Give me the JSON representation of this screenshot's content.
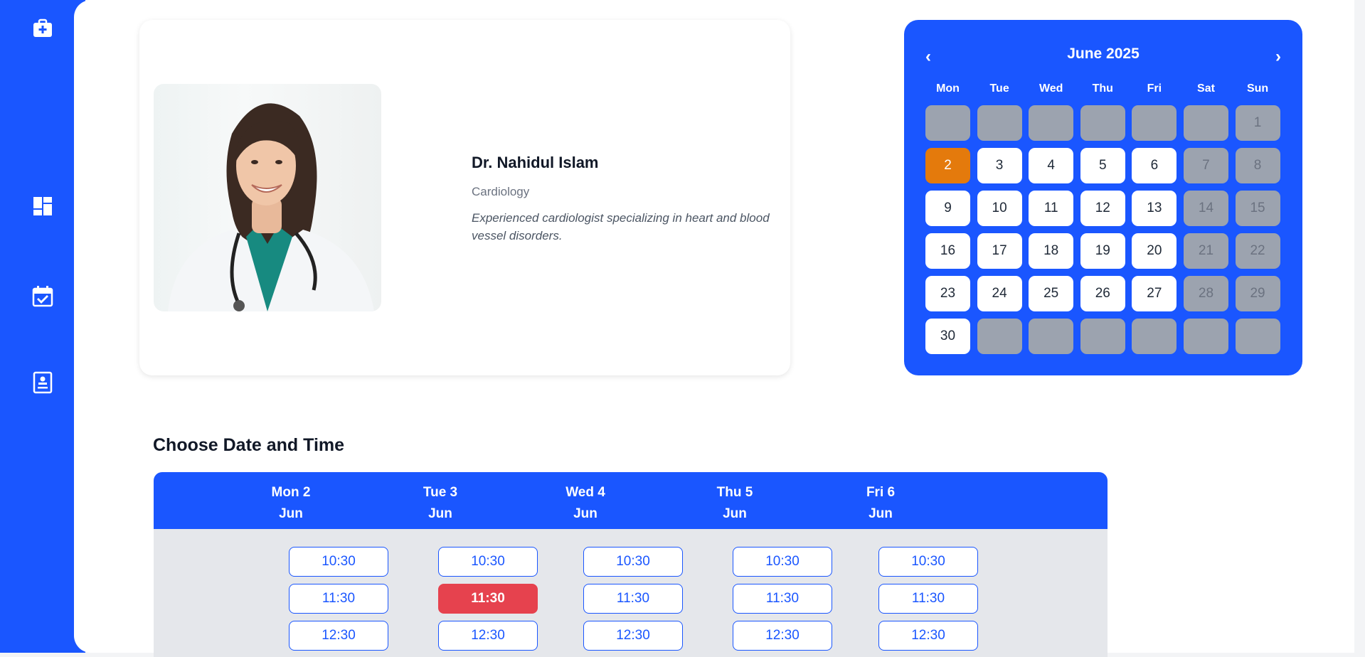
{
  "sidebar": {
    "icons": [
      "medical-kit-icon",
      "dashboard-icon",
      "calendar-check-icon",
      "profile-card-icon"
    ]
  },
  "doctor": {
    "name": "Dr. Nahidul Islam",
    "specialty": "Cardiology",
    "description": "Experienced cardiologist specializing in heart and blood vessel disorders."
  },
  "calendar": {
    "month_title": "June 2025",
    "prev_label": "‹",
    "next_label": "›",
    "weekdays": [
      "Mon",
      "Tue",
      "Wed",
      "Thu",
      "Fri",
      "Sat",
      "Sun"
    ],
    "cells": [
      {
        "label": "",
        "state": "empty"
      },
      {
        "label": "",
        "state": "empty"
      },
      {
        "label": "",
        "state": "empty"
      },
      {
        "label": "",
        "state": "empty"
      },
      {
        "label": "",
        "state": "empty"
      },
      {
        "label": "",
        "state": "empty"
      },
      {
        "label": "1",
        "state": "disabled"
      },
      {
        "label": "2",
        "state": "selected"
      },
      {
        "label": "3",
        "state": "available"
      },
      {
        "label": "4",
        "state": "available"
      },
      {
        "label": "5",
        "state": "available"
      },
      {
        "label": "6",
        "state": "available"
      },
      {
        "label": "7",
        "state": "disabled"
      },
      {
        "label": "8",
        "state": "disabled"
      },
      {
        "label": "9",
        "state": "available"
      },
      {
        "label": "10",
        "state": "available"
      },
      {
        "label": "11",
        "state": "available"
      },
      {
        "label": "12",
        "state": "available"
      },
      {
        "label": "13",
        "state": "available"
      },
      {
        "label": "14",
        "state": "disabled"
      },
      {
        "label": "15",
        "state": "disabled"
      },
      {
        "label": "16",
        "state": "available"
      },
      {
        "label": "17",
        "state": "available"
      },
      {
        "label": "18",
        "state": "available"
      },
      {
        "label": "19",
        "state": "available"
      },
      {
        "label": "20",
        "state": "available"
      },
      {
        "label": "21",
        "state": "disabled"
      },
      {
        "label": "22",
        "state": "disabled"
      },
      {
        "label": "23",
        "state": "available"
      },
      {
        "label": "24",
        "state": "available"
      },
      {
        "label": "25",
        "state": "available"
      },
      {
        "label": "26",
        "state": "available"
      },
      {
        "label": "27",
        "state": "available"
      },
      {
        "label": "28",
        "state": "disabled"
      },
      {
        "label": "29",
        "state": "disabled"
      },
      {
        "label": "30",
        "state": "available"
      },
      {
        "label": "",
        "state": "empty"
      },
      {
        "label": "",
        "state": "empty"
      },
      {
        "label": "",
        "state": "empty"
      },
      {
        "label": "",
        "state": "empty"
      },
      {
        "label": "",
        "state": "empty"
      },
      {
        "label": "",
        "state": "empty"
      }
    ]
  },
  "schedule": {
    "title": "Choose Date and Time",
    "days": [
      {
        "line1": "Mon 2",
        "line2": "Jun",
        "slots": [
          {
            "time": "10:30",
            "booked": false
          },
          {
            "time": "11:30",
            "booked": false
          },
          {
            "time": "12:30",
            "booked": false
          }
        ]
      },
      {
        "line1": "Tue 3",
        "line2": "Jun",
        "slots": [
          {
            "time": "10:30",
            "booked": false
          },
          {
            "time": "11:30",
            "booked": true
          },
          {
            "time": "12:30",
            "booked": false
          }
        ]
      },
      {
        "line1": "Wed 4",
        "line2": "Jun",
        "slots": [
          {
            "time": "10:30",
            "booked": false
          },
          {
            "time": "11:30",
            "booked": false
          },
          {
            "time": "12:30",
            "booked": false
          }
        ]
      },
      {
        "line1": "Thu 5",
        "line2": "Jun",
        "slots": [
          {
            "time": "10:30",
            "booked": false
          },
          {
            "time": "11:30",
            "booked": false
          },
          {
            "time": "12:30",
            "booked": false
          }
        ]
      },
      {
        "line1": "Fri 6",
        "line2": "Jun",
        "slots": [
          {
            "time": "10:30",
            "booked": false
          },
          {
            "time": "11:30",
            "booked": false
          },
          {
            "time": "12:30",
            "booked": false
          }
        ]
      }
    ]
  },
  "colors": {
    "primary": "#1a56ff",
    "selected_day": "#e47a0c",
    "booked_slot": "#e6424e",
    "disabled_day": "#9ca3af"
  }
}
